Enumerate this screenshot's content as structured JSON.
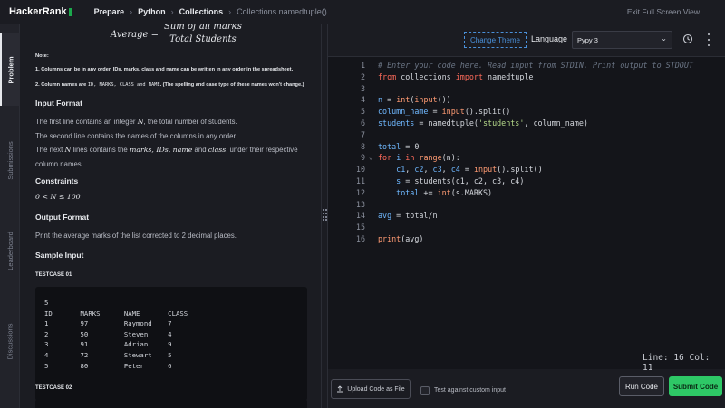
{
  "app": {
    "logo": "HackerRank"
  },
  "breadcrumb": {
    "items": [
      "Prepare",
      "Python",
      "Collections"
    ],
    "current": "Collections.namedtuple()"
  },
  "header": {
    "exit_label": "Exit Full Screen View"
  },
  "side_tabs": [
    "Problem",
    "Submissions",
    "Leaderboard",
    "Discussions"
  ],
  "problem": {
    "formula": {
      "lhs": "Average =",
      "numerator": "Sum of all marks",
      "denominator": "Total Students"
    },
    "note_title": "Note:",
    "note1": "1. Columns can be in any order. IDs, marks, class and name can be written in any order in the spreadsheet.",
    "note2_prefix": "2. Column names are ",
    "note2_codes": "ID, MARKS, CLASS and NAME",
    "note2_suffix": ". (The spelling and case type of these names won't change.)",
    "input_format_title": "Input Format",
    "input_line1_a": "The first line contains an integer ",
    "input_line1_math": "N",
    "input_line1_b": ", the total number of students.",
    "input_line2": "The second line contains the names of the columns in any order.",
    "input_line3_a": "The next ",
    "input_line3_math1": "N",
    "input_line3_b": " lines contains the ",
    "input_line3_math2": "marks, IDs, name",
    "input_line3_c": " and ",
    "input_line3_math3": "class",
    "input_line3_d": ", under their respective",
    "input_line4": "column names.",
    "constraints_title": "Constraints",
    "constraint": "0 < N ≤ 100",
    "output_format_title": "Output Format",
    "output_text": "Print the average marks of the list corrected to 2 decimal places.",
    "sample_input_title": "Sample Input",
    "testcase1_label": "TESTCASE 01",
    "testcase1_text": "5\nID       MARKS      NAME       CLASS\n1        97         Raymond    7\n2        50         Steven     4\n3        91         Adrian     9\n4        72         Stewart    5\n5        80         Peter      6",
    "testcase2_label": "TESTCASE 02"
  },
  "editor": {
    "change_theme": "Change Theme",
    "language_label": "Language",
    "language_value": "Pypy 3",
    "status": "Line: 16 Col: 11"
  },
  "footer": {
    "upload_label": "Upload Code as File",
    "custom_input_label": "Test against custom input",
    "run_label": "Run Code",
    "submit_label": "Submit Code"
  },
  "colors": {
    "accent_green": "#2ec866",
    "link_blue": "#4a90d9"
  }
}
